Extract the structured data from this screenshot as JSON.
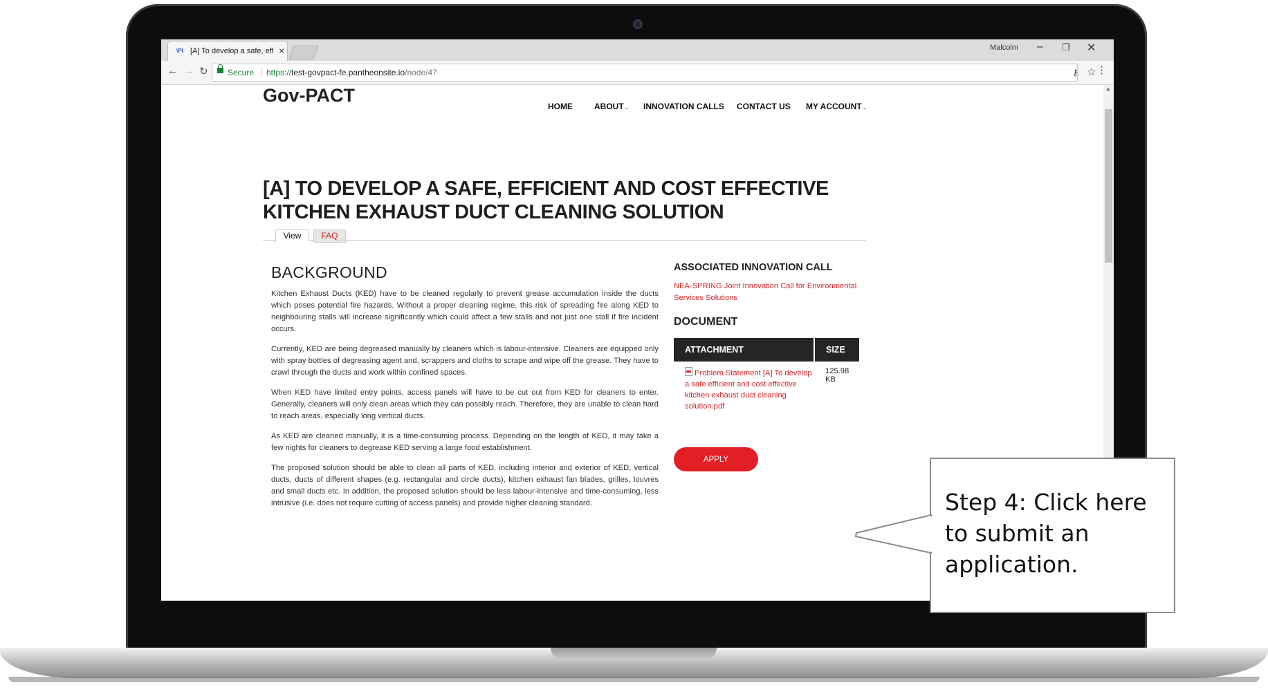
{
  "browser": {
    "tab_title": "[A] To develop a safe, effi",
    "tab_close": "×",
    "user_name": "Malcolm",
    "secure_label": "Secure",
    "url_scheme": "https://",
    "url_host": "test-govpact-fe.pantheonsite.io",
    "url_path": "/node/47"
  },
  "site": {
    "logo": "Gov-PACT",
    "nav": {
      "home": "HOME",
      "about": "ABOUT",
      "innovation_calls": "INNOVATION CALLS",
      "contact": "CONTACT US",
      "my_account": "MY ACCOUNT"
    }
  },
  "page": {
    "title": "[A] TO DEVELOP A SAFE, EFFICIENT AND COST EFFECTIVE KITCHEN EXHAUST DUCT CLEANING SOLUTION",
    "tabs": {
      "view": "View",
      "faq": "FAQ"
    },
    "background_heading": "BACKGROUND",
    "background_paragraphs": [
      "Kitchen Exhaust Ducts (KED) have to be cleaned regularly to prevent grease accumulation inside the ducts which poses potential fire hazards. Without a proper cleaning regime, this risk of spreading fire along KED to neighbouring stalls will increase significantly which could affect a few stalls and not just one stall if fire incident occurs.",
      "Currently, KED are being degreased manually by cleaners which is labour-intensive. Cleaners are equipped only with spray bottles of degreasing agent and, scrappers and cloths to scrape and wipe off the grease. They have to crawl through the ducts and work within confined spaces.",
      "When KED have limited entry points, access panels will have to be cut out from KED for cleaners to enter. Generally, cleaners will only clean areas which they can possibly reach. Therefore, they are unable to clean hard to reach areas, especially long vertical ducts.",
      "As KED are cleaned manually, it is a time-consuming process. Depending on the length of KED, it may take a few nights for cleaners to degrease KED serving a large food establishment.",
      "The proposed solution should be able to clean all parts of KED, including interior and exterior of KED, vertical ducts, ducts of different shapes (e.g. rectangular and circle ducts), kitchen exhaust fan blades, grilles, louvres and small ducts etc. In addition, the proposed solution should be less labour-intensive and time-consuming, less intrusive (i.e. does not require cutting of access panels) and provide higher cleaning standard."
    ],
    "assoc_heading": "ASSOCIATED INNOVATION CALL",
    "assoc_link": "NEA-SPRING Joint Innovation Call for Environmental Services Solutions",
    "document_heading": "DOCUMENT",
    "table": {
      "col_attachment": "ATTACHMENT",
      "col_size": "SIZE",
      "file_name": "Problem Statement [A] To develop a safe efficient and cost effective kitchen exhaust duct cleaning solution.pdf",
      "file_size": "125.98 KB"
    },
    "apply_label": "APPLY"
  },
  "callout": {
    "text": "Step 4: Click here to submit an application."
  },
  "colors": {
    "accent_red": "#e31e24",
    "link_red": "#d6262b",
    "table_header": "#252525",
    "secure_green": "#188038"
  },
  "icons": [
    "favicon",
    "close-icon",
    "back-icon",
    "forward-icon",
    "reload-icon",
    "lock-icon",
    "key-icon",
    "star-icon",
    "menu-icon",
    "chevron-down-icon",
    "pdf-icon",
    "scroll-up-icon"
  ]
}
